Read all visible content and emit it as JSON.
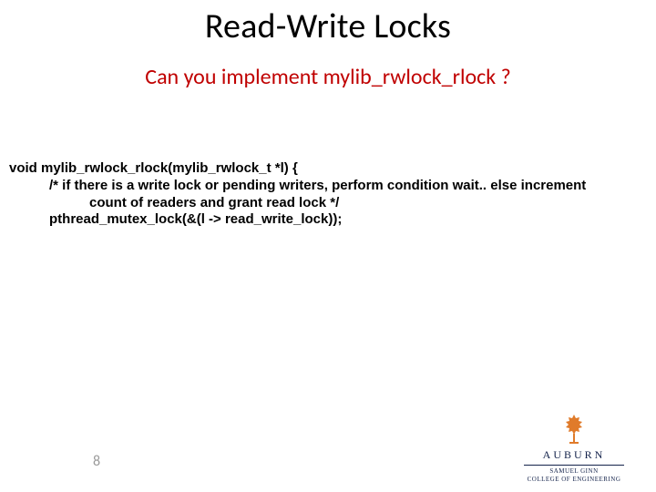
{
  "title": "Read-Write Locks",
  "subtitle_prefix": "Can you implement ",
  "subtitle_func": "mylib_rwlock_rlock",
  "subtitle_suffix": " ?",
  "code": {
    "l1": "void mylib_rwlock_rlock(mylib_rwlock_t *l) {",
    "l2a": "/* if there is a write lock or pending writers, perform condition wait.. else increment",
    "l3": "count of readers and grant read lock */",
    "l2b": "pthread_mutex_lock(&(l -> read_write_lock));"
  },
  "page_number": "8",
  "logo": {
    "name": "AUBURN",
    "sub1": "SAMUEL GINN",
    "sub2": "COLLEGE OF ENGINEERING"
  }
}
